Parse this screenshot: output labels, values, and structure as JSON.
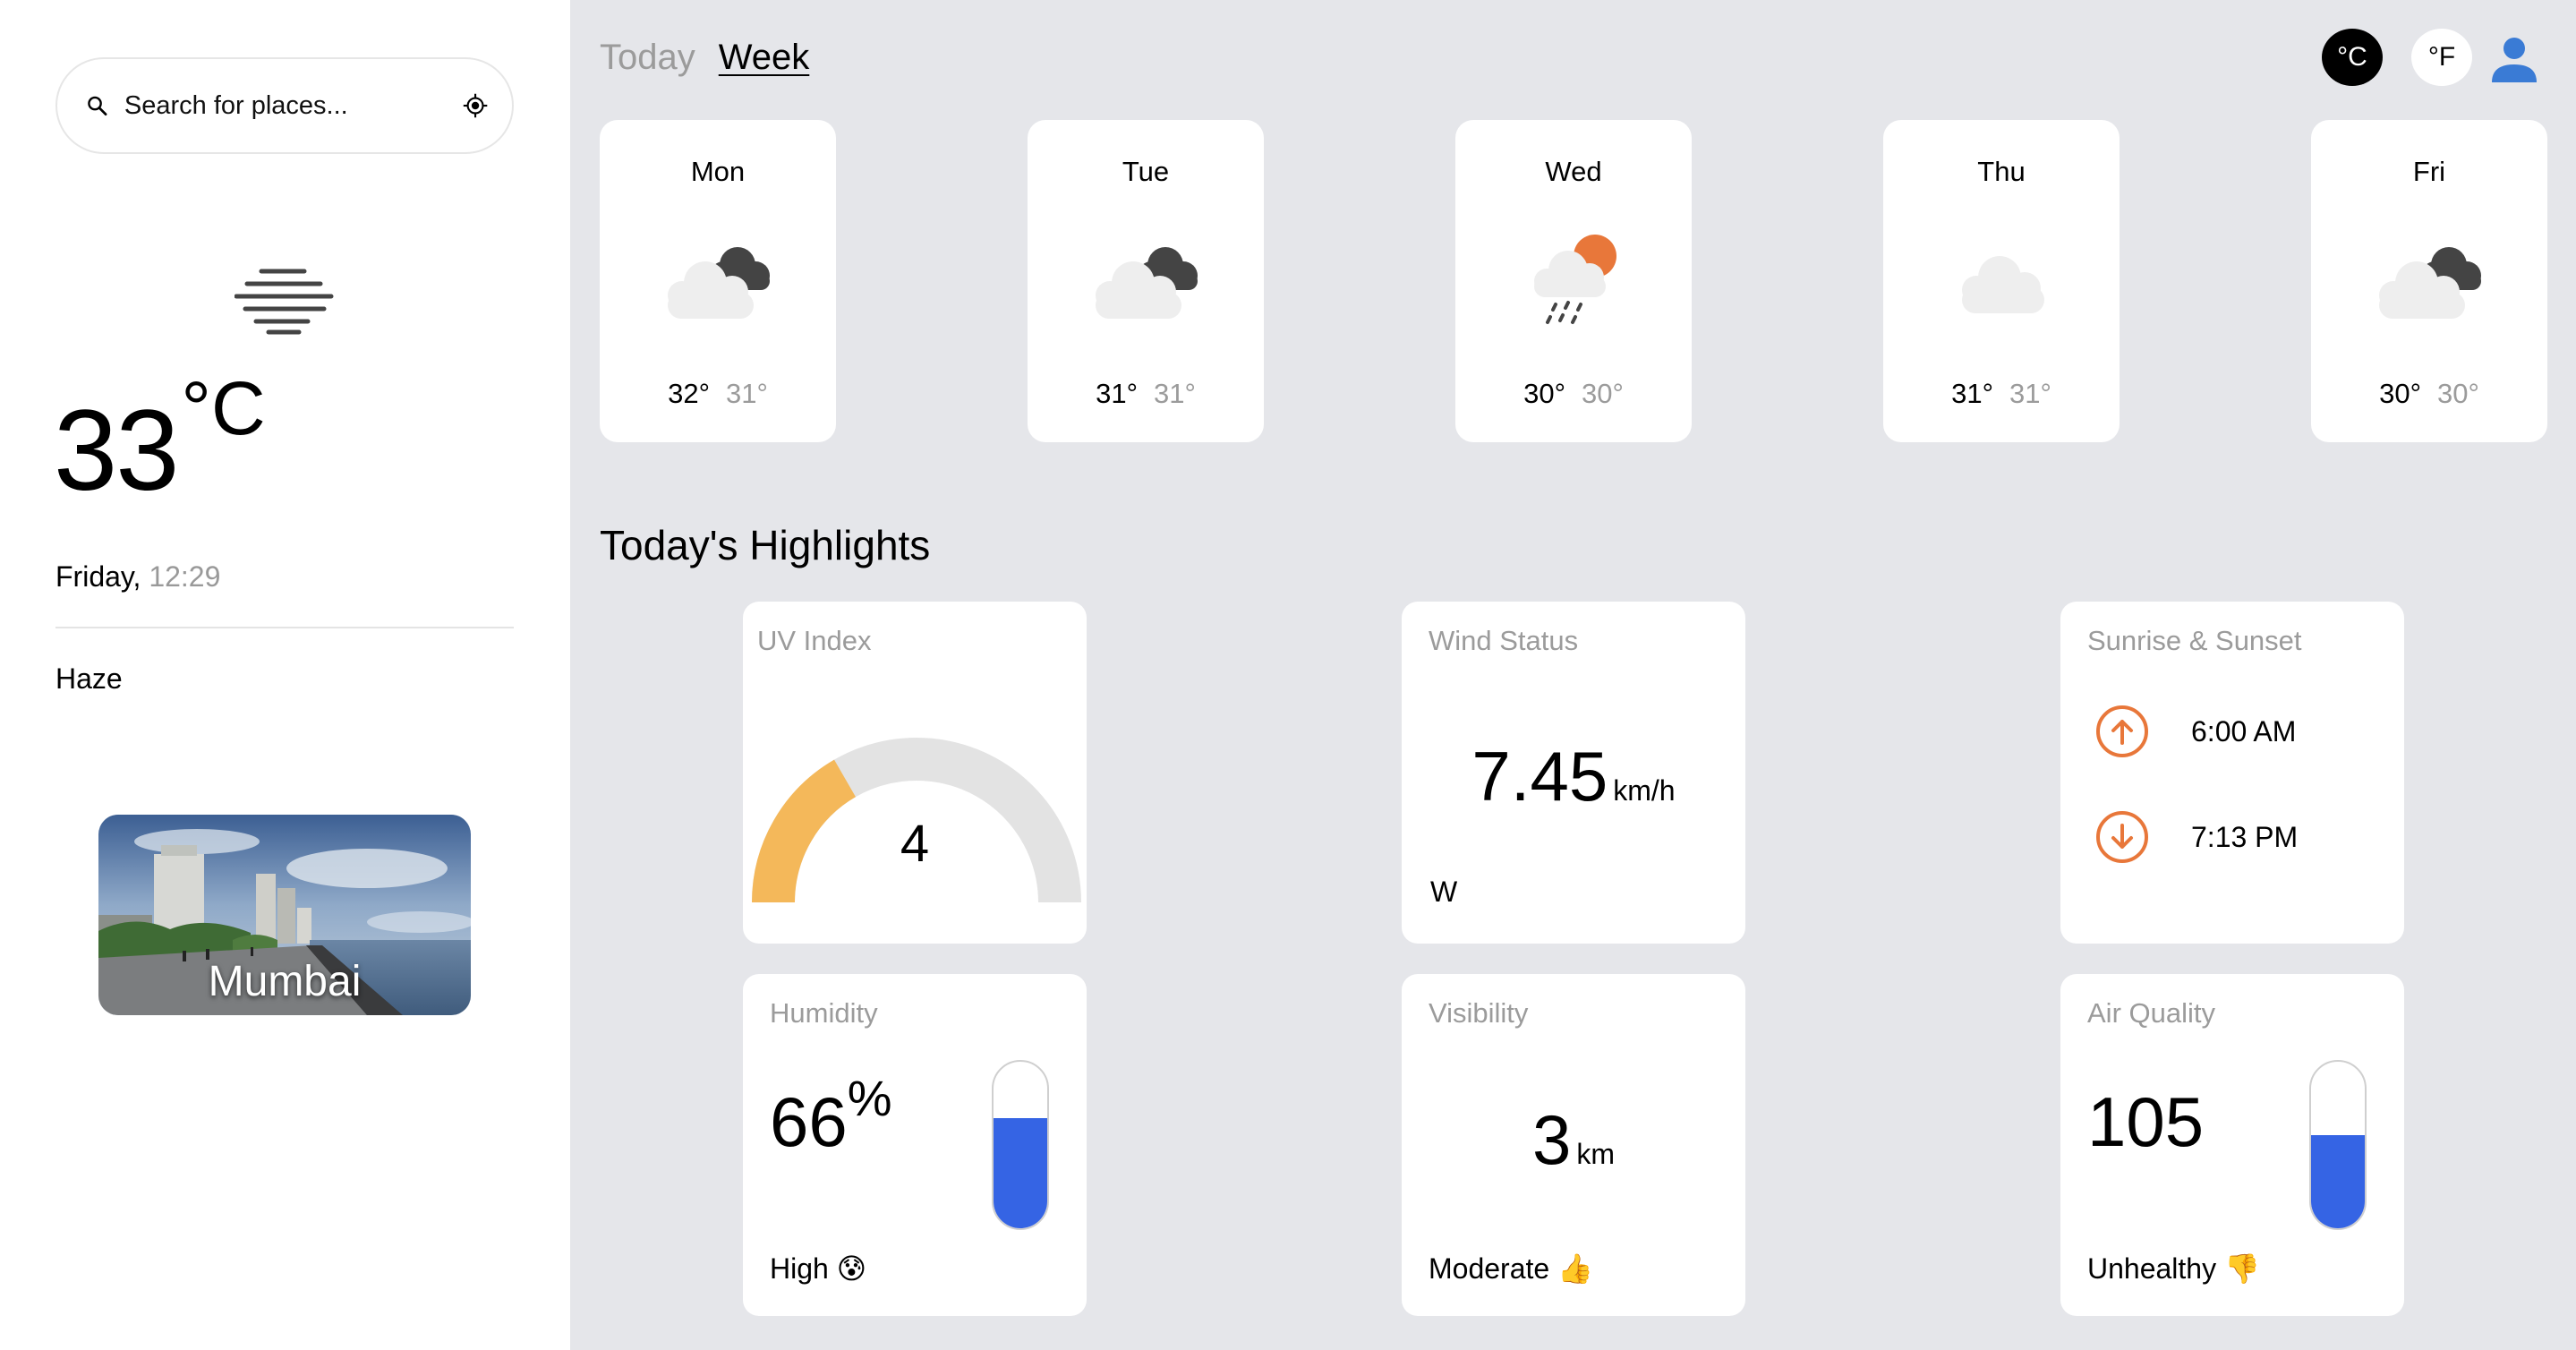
{
  "search": {
    "placeholder": "Search for places..."
  },
  "current": {
    "temp": "33",
    "unit": "°C",
    "day": "Friday,",
    "time": "12:29",
    "condition": "Haze",
    "city": "Mumbai",
    "weather_icon": "haze-icon"
  },
  "header": {
    "tabs": [
      {
        "label": "Today",
        "active": false
      },
      {
        "label": "Week",
        "active": true
      }
    ],
    "units": {
      "celsius": "°C",
      "fahrenheit": "°F",
      "selected": "celsius"
    },
    "user_icon": "user-icon"
  },
  "week": [
    {
      "day": "Mon",
      "max": "32°",
      "min": "31°",
      "icon": "cloudy-icon"
    },
    {
      "day": "Tue",
      "max": "31°",
      "min": "31°",
      "icon": "cloudy-icon"
    },
    {
      "day": "Wed",
      "max": "30°",
      "min": "30°",
      "icon": "rain-sun-icon"
    },
    {
      "day": "Thu",
      "max": "31°",
      "min": "31°",
      "icon": "cloud-icon"
    },
    {
      "day": "Fri",
      "max": "30°",
      "min": "30°",
      "icon": "cloudy-icon"
    }
  ],
  "highlights": {
    "title": "Today's Highlights",
    "uv": {
      "label": "UV Index",
      "value": "4",
      "max": 12
    },
    "wind": {
      "label": "Wind Status",
      "value": "7.45",
      "unit": "km/h",
      "direction": "W"
    },
    "sun": {
      "label": "Sunrise & Sunset",
      "sunrise": "6:00 AM",
      "sunset": "7:13 PM"
    },
    "humidity": {
      "label": "Humidity",
      "value": "66",
      "unit": "%",
      "status": "High 😰",
      "level_percent": 66
    },
    "visibility": {
      "label": "Visibility",
      "value": "3",
      "unit": "km",
      "status": "Moderate 👍"
    },
    "air": {
      "label": "Air Quality",
      "value": "105",
      "status": "Unhealthy 👎",
      "level_percent": 56
    }
  },
  "colors": {
    "accent_dark": "#000000",
    "bar_fill": "#3564e4",
    "uv_fill": "#f4b85a",
    "sun_icon": "#e8773a",
    "muted_text": "#9b9b9b",
    "background": "#e5e6ea"
  }
}
